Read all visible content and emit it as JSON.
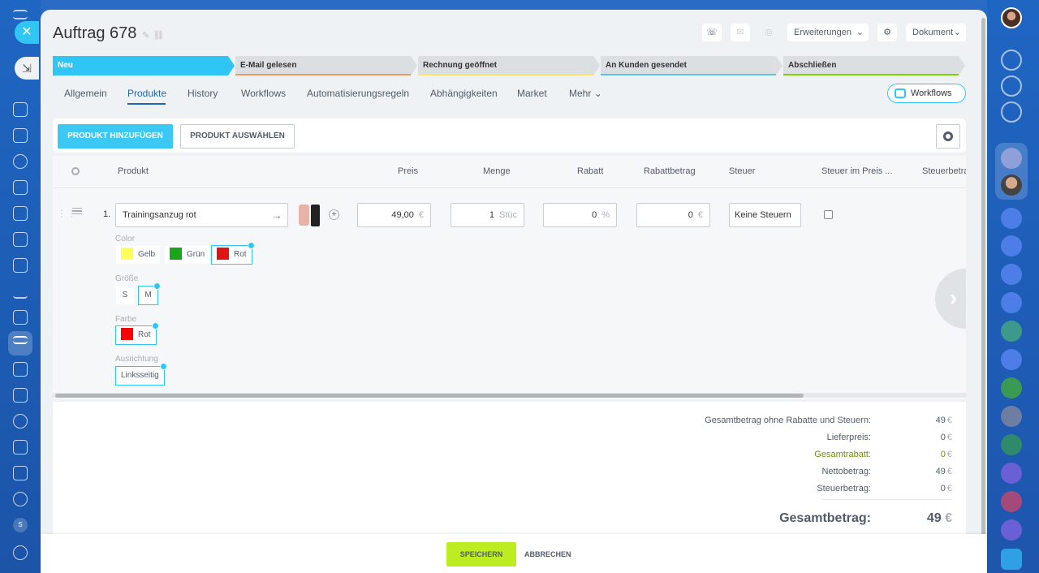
{
  "header": {
    "title": "Auftrag 678",
    "extensions_label": "Erweiterungen",
    "document_label": "Dokument"
  },
  "stages": [
    {
      "label": "Neu",
      "color": "#2fc6f6",
      "active": true
    },
    {
      "label": "E-Mail gelesen",
      "color": "#e89b65",
      "active": false
    },
    {
      "label": "Rechnung geöffnet",
      "color": "#ffe46b",
      "active": false
    },
    {
      "label": "An Kunden gesendet",
      "color": "#5fc4e5",
      "active": false
    },
    {
      "label": "Abschließen",
      "color": "#7bd500",
      "active": false
    }
  ],
  "tabs": [
    {
      "label": "Allgemein",
      "active": false
    },
    {
      "label": "Produkte",
      "active": true
    },
    {
      "label": "History",
      "active": false
    },
    {
      "label": "Workflows",
      "active": false
    },
    {
      "label": "Automatisierungsregeln",
      "active": false
    },
    {
      "label": "Abhängigkeiten",
      "active": false
    },
    {
      "label": "Market",
      "active": false
    },
    {
      "label": "Mehr",
      "active": false
    }
  ],
  "workflows_button": "Workflows",
  "toolbar": {
    "add_product": "PRODUKT HINZUFÜGEN",
    "select_product": "PRODUKT AUSWÄHLEN"
  },
  "table": {
    "columns": [
      "Produkt",
      "Preis",
      "Menge",
      "Rabatt",
      "Rabattbetrag",
      "Steuer",
      "Steuer im Preis ...",
      "Steuerbetrag"
    ],
    "row": {
      "number": "1.",
      "name": "Trainingsanzug rot",
      "price": "49,00",
      "price_unit": "€",
      "quantity": "1",
      "quantity_unit": "Stüc",
      "discount": "0",
      "discount_unit": "%",
      "discount_amount": "0",
      "discount_amount_unit": "€",
      "tax": "Keine Steuern",
      "tax_included": false
    },
    "variants": {
      "color": {
        "label": "Color",
        "options": [
          {
            "label": "Gelb",
            "swatch": "#fdfd5c",
            "selected": false
          },
          {
            "label": "Grün",
            "swatch": "#1aa61a",
            "selected": false
          },
          {
            "label": "Rot",
            "swatch": "#e01414",
            "selected": true
          }
        ]
      },
      "size": {
        "label": "Größe",
        "options": [
          {
            "label": "S",
            "selected": false
          },
          {
            "label": "M",
            "selected": true
          }
        ]
      },
      "farbe": {
        "label": "Farbe",
        "options": [
          {
            "label": "Rot",
            "swatch": "#ff0000",
            "selected": true
          }
        ]
      },
      "orientation": {
        "label": "Ausrichtung",
        "options": [
          {
            "label": "Linksseitig",
            "selected": true
          }
        ]
      }
    }
  },
  "summary": {
    "rows": [
      {
        "label": "Gesamtbetrag ohne Rabatte und Steuern:",
        "value": "49",
        "currency": "€",
        "highlight": false
      },
      {
        "label": "Lieferpreis:",
        "value": "0",
        "currency": "€",
        "highlight": false
      },
      {
        "label": "Gesamtrabatt:",
        "value": "0",
        "currency": "€",
        "highlight": true
      },
      {
        "label": "Nettobetrag:",
        "value": "49",
        "currency": "€",
        "highlight": false
      },
      {
        "label": "Steuerbetrag:",
        "value": "0",
        "currency": "€",
        "highlight": false
      }
    ],
    "total_label": "Gesamtbetrag:",
    "total_value": "49",
    "total_currency": "€"
  },
  "footer": {
    "save": "SPEICHERN",
    "cancel": "ABBRECHEN"
  },
  "left_nav": {
    "close_icon": "close-icon",
    "back_icon": "arrow-down-right-icon",
    "badge": "S"
  },
  "colors": {
    "accent": "#2fc6f6",
    "active_tab": "#2067b0",
    "save_button": "#bbed21",
    "panel_bg": "#eef2f4"
  }
}
